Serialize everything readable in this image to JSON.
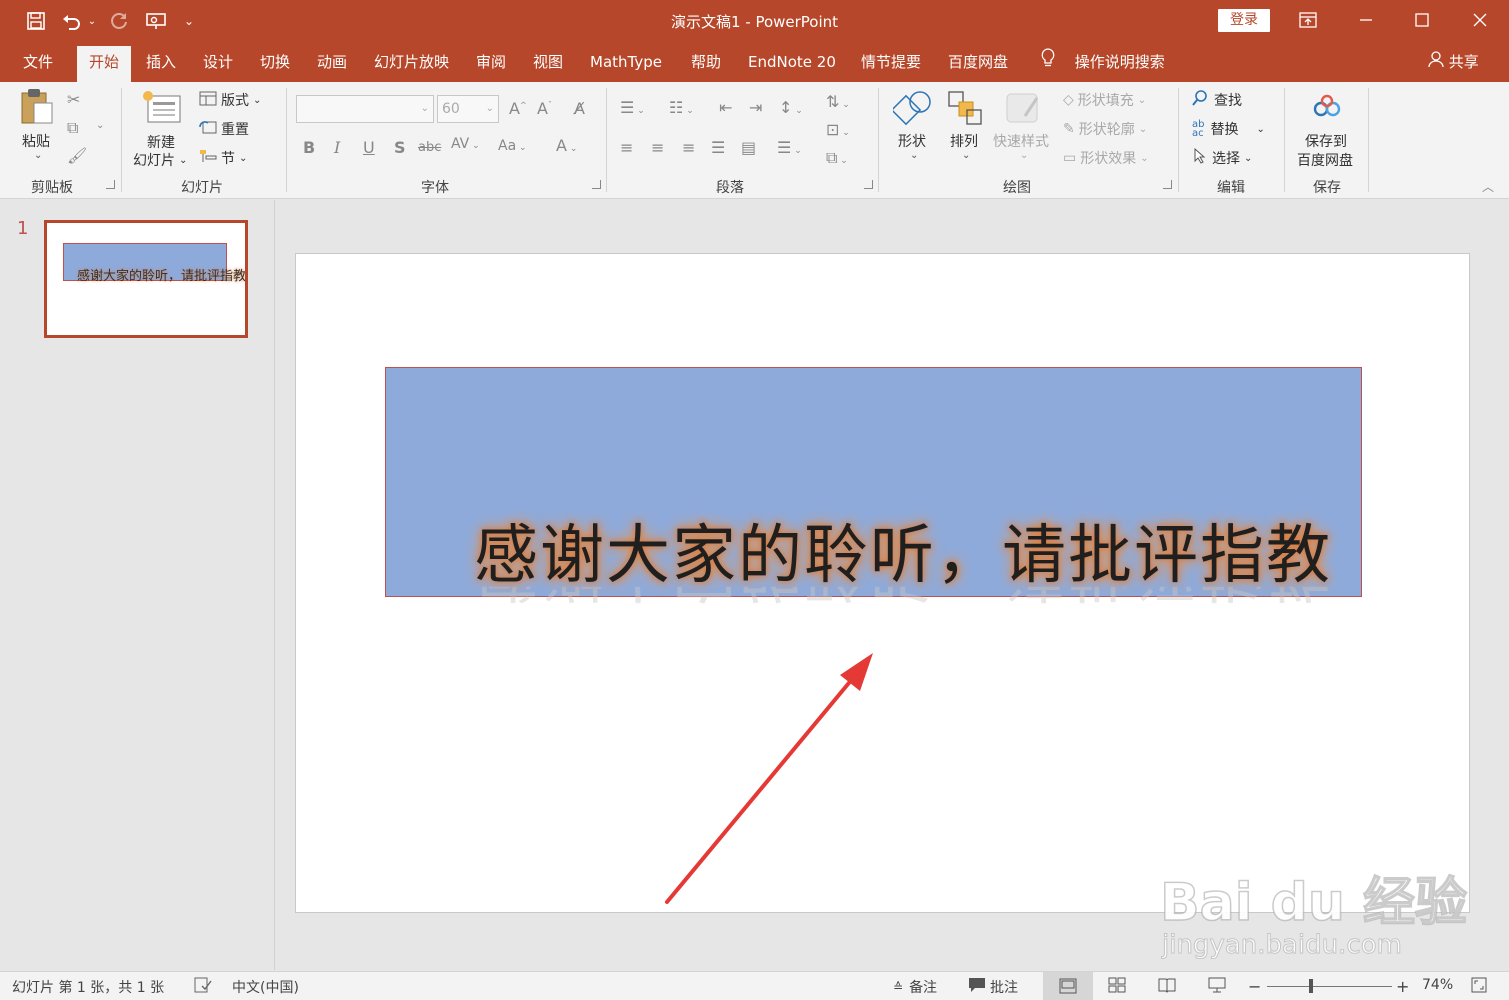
{
  "window": {
    "title": "演示文稿1 - PowerPoint",
    "login_label": "登录"
  },
  "tabs": [
    {
      "label": "文件"
    },
    {
      "label": "开始"
    },
    {
      "label": "插入"
    },
    {
      "label": "设计"
    },
    {
      "label": "切换"
    },
    {
      "label": "动画"
    },
    {
      "label": "幻灯片放映"
    },
    {
      "label": "审阅"
    },
    {
      "label": "视图"
    },
    {
      "label": "MathType"
    },
    {
      "label": "帮助"
    },
    {
      "label": "EndNote 20"
    },
    {
      "label": "情节提要"
    },
    {
      "label": "百度网盘"
    }
  ],
  "tell_me": "操作说明搜索",
  "share": "共享",
  "ribbon": {
    "clipboard": {
      "paste": "粘贴",
      "group": "剪贴板"
    },
    "slides": {
      "new_slide_1": "新建",
      "new_slide_2": "幻灯片",
      "layout": "版式",
      "reset": "重置",
      "section": "节",
      "group": "幻灯片"
    },
    "font": {
      "font_size": "60",
      "group": "字体"
    },
    "paragraph": {
      "group": "段落"
    },
    "drawing": {
      "shapes": "形状",
      "arrange": "排列",
      "quick_styles": "快速样式",
      "fill": "形状填充",
      "outline": "形状轮廓",
      "effects": "形状效果",
      "group": "绘图"
    },
    "editing": {
      "find": "查找",
      "replace": "替换",
      "select": "选择",
      "group": "编辑"
    },
    "save": {
      "save_to_1": "保存到",
      "save_to_2": "百度网盘",
      "group": "保存"
    }
  },
  "thumbnails": [
    {
      "number": "1",
      "text": "感谢大家的聆听，请批评指教"
    }
  ],
  "slide": {
    "text": "感谢大家的聆听，请批评指教"
  },
  "watermark": {
    "logo": "Bai du 经验",
    "url": "jingyan.baidu.com"
  },
  "statusbar": {
    "slide_info": "幻灯片 第 1 张，共 1 张",
    "language": "中文(中国)",
    "notes": "备注",
    "comments": "批注",
    "zoom": "74%"
  },
  "colors": {
    "accent": "#b7472a",
    "shape_fill": "#8eaadb",
    "shape_border": "#c0504d",
    "glow": "#e08a4a",
    "arrow": "#e53935"
  }
}
